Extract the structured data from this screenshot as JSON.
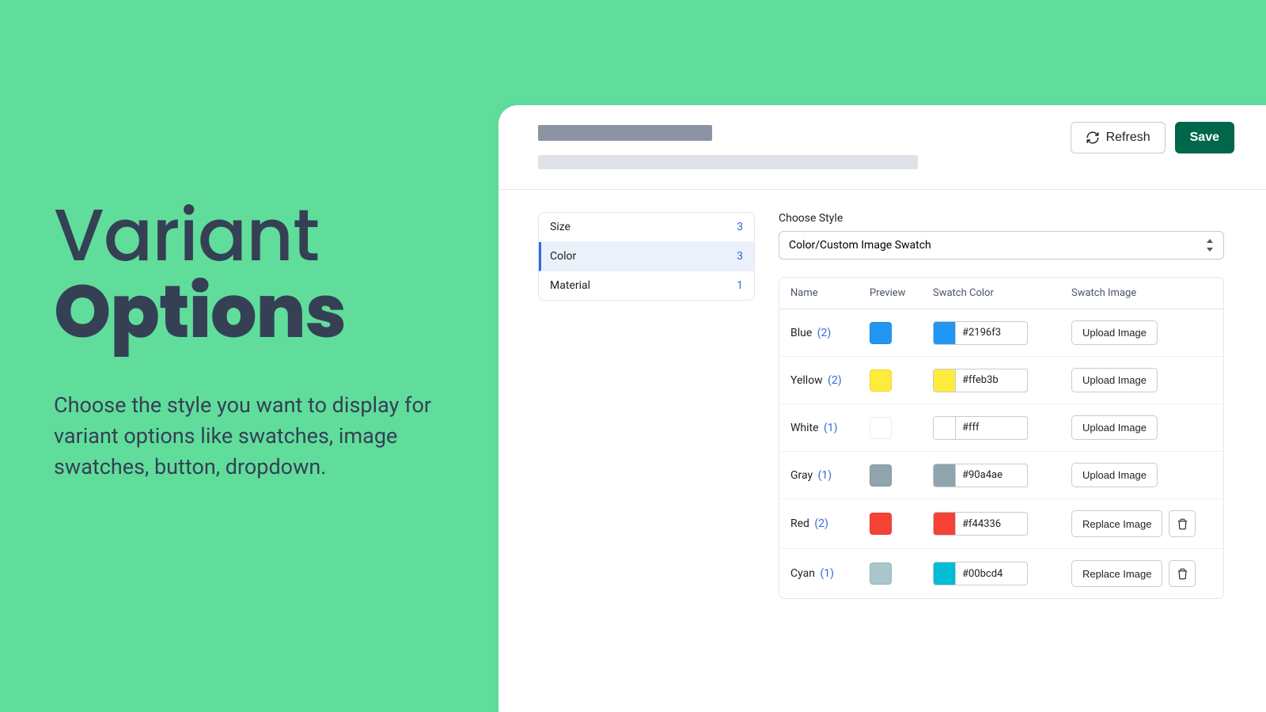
{
  "left": {
    "headline_line1": "Variant",
    "headline_line2": "Options",
    "subtext": "Choose the style you want to display for variant options like swatches, image swatches, button, dropdown."
  },
  "header": {
    "refresh_label": "Refresh",
    "save_label": "Save"
  },
  "sidebar": {
    "items": [
      {
        "label": "Size",
        "count": "3",
        "active": false
      },
      {
        "label": "Color",
        "count": "3",
        "active": true
      },
      {
        "label": "Material",
        "count": "1",
        "active": false
      }
    ]
  },
  "style": {
    "label": "Choose Style",
    "selected": "Color/Custom Image Swatch"
  },
  "table": {
    "columns": {
      "name": "Name",
      "preview": "Preview",
      "swatch_color": "Swatch Color",
      "swatch_image": "Swatch Image"
    },
    "upload_label": "Upload Image",
    "replace_label": "Replace Image",
    "rows": [
      {
        "name": "Blue",
        "count": "(2)",
        "preview": "#2196f3",
        "hex": "#2196f3",
        "action": "upload",
        "trash": false
      },
      {
        "name": "Yellow",
        "count": "(2)",
        "preview": "#ffeb3b",
        "hex": "#ffeb3b",
        "action": "upload",
        "trash": false
      },
      {
        "name": "White",
        "count": "(1)",
        "preview": "#ffffff",
        "hex": "#fff",
        "action": "upload",
        "trash": false
      },
      {
        "name": "Gray",
        "count": "(1)",
        "preview": "#90a4ae",
        "hex": "#90a4ae",
        "action": "upload",
        "trash": false
      },
      {
        "name": "Red",
        "count": "(2)",
        "preview": "#f44336",
        "hex": "#f44336",
        "action": "replace",
        "trash": true
      },
      {
        "name": "Cyan",
        "count": "(1)",
        "preview": "#a9c6cc",
        "hex": "#00bcd4",
        "action": "replace",
        "trash": true,
        "chip": "#00bcd4"
      }
    ]
  }
}
